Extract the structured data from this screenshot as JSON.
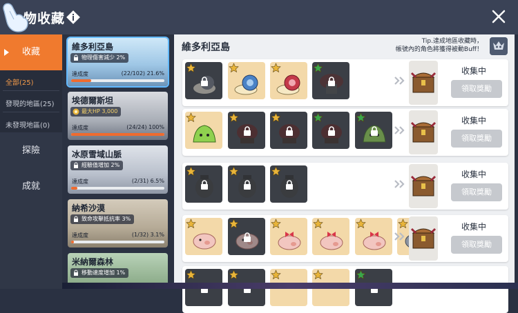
{
  "header": {
    "title": "物收藏",
    "close_icon": "close-icon",
    "info_icon": "diamond-info-icon"
  },
  "leftnav": {
    "tabs": [
      {
        "label": "收藏",
        "active": true
      },
      {
        "label": "探險",
        "active": false
      },
      {
        "label": "成就",
        "active": false
      }
    ],
    "filters": [
      {
        "label": "全部(25)",
        "active": true
      },
      {
        "label": "發現的地區(25)",
        "active": false
      },
      {
        "label": "未發現地區(0)",
        "active": false
      }
    ]
  },
  "regions": [
    {
      "name": "維多利亞島",
      "buff": "物理傷害減少 2%",
      "buff_icon": "lock-icon",
      "progress_label": "達成度",
      "progress_text": "(22/102) 21.6%",
      "progress": 0.216,
      "active": true
    },
    {
      "name": "埃德爾斯坦",
      "buff": "最大HP 3,000",
      "buff_icon": "medal-icon",
      "progress_label": "達成度",
      "progress_text": "(24/24) 100%",
      "progress": 1.0,
      "active": false
    },
    {
      "name": "冰原雪域山脈",
      "buff": "經驗值增加 2%",
      "buff_icon": "lock-icon",
      "progress_label": "達成度",
      "progress_text": "(2/31) 6.5%",
      "progress": 0.065,
      "active": false
    },
    {
      "name": "納希沙漠",
      "buff": "致命攻擊抵抗率 3%",
      "buff_icon": "lock-icon",
      "progress_label": "達成度",
      "progress_text": "(1/32) 3.1%",
      "progress": 0.031,
      "active": false
    },
    {
      "name": "米納爾森林",
      "buff": "移動速度增加 1%",
      "buff_icon": "lock-icon",
      "progress_label": "",
      "progress_text": "",
      "progress": 0,
      "active": false
    }
  ],
  "main": {
    "title": "維多利亞島",
    "tip_line1": "Tip.達成地區收藏時，",
    "tip_line2": "帳號內的角色將獲得被動Buff！",
    "rows": [
      {
        "status": "收集中",
        "button": "領取獎勵",
        "slots": [
          {
            "state": "locked",
            "star": "gold",
            "monster": "snail-icon"
          },
          {
            "state": "collected",
            "star": "gold",
            "monster": "blue-snail-icon"
          },
          {
            "state": "collected",
            "star": "gold",
            "monster": "red-snail-icon"
          },
          {
            "state": "locked",
            "star": "green",
            "monster": "mushroom-icon"
          }
        ]
      },
      {
        "status": "收集中",
        "button": "領取獎勵",
        "slots": [
          {
            "state": "collected",
            "star": "gold",
            "monster": "slime-icon"
          },
          {
            "state": "locked",
            "star": "gold",
            "monster": "stump-icon"
          },
          {
            "state": "locked",
            "star": "gold",
            "monster": "stump-icon"
          },
          {
            "state": "locked",
            "star": "green",
            "monster": "stump-icon"
          },
          {
            "state": "locked",
            "star": "green",
            "monster": "slime-icon"
          }
        ]
      },
      {
        "status": "收集中",
        "button": "領取獎勵",
        "slots": [
          {
            "state": "locked",
            "star": "gold",
            "monster": "pot-icon"
          },
          {
            "state": "locked",
            "star": "gold",
            "monster": "pot-icon"
          },
          {
            "state": "locked",
            "star": "gold",
            "monster": "pot-icon"
          }
        ]
      },
      {
        "status": "收集中",
        "button": "領取獎勵",
        "slots": [
          {
            "state": "collected",
            "star": "gold",
            "monster": "pig-icon"
          },
          {
            "state": "locked",
            "star": "gold",
            "monster": "pig-icon"
          },
          {
            "state": "collected",
            "star": "gold",
            "monster": "ribbon-pig-icon"
          },
          {
            "state": "collected",
            "star": "gold",
            "monster": "ribbon-pig-icon"
          },
          {
            "state": "collected",
            "star": "gold",
            "monster": "ribbon-pig-icon"
          },
          {
            "state": "collected",
            "star": "gold",
            "monster": "iron-hog-icon"
          }
        ]
      },
      {
        "status": "",
        "button": "",
        "slots": [
          {
            "state": "locked",
            "star": "gold",
            "monster": ""
          },
          {
            "state": "locked",
            "star": "gold",
            "monster": ""
          },
          {
            "state": "collected",
            "star": "gold",
            "monster": ""
          },
          {
            "state": "collected",
            "star": "gold",
            "monster": ""
          },
          {
            "state": "locked",
            "star": "green",
            "monster": ""
          }
        ]
      }
    ]
  },
  "colors": {
    "accent": "#f07a2e",
    "gold_star": "#e8b43a",
    "green_star": "#3aa64b"
  }
}
